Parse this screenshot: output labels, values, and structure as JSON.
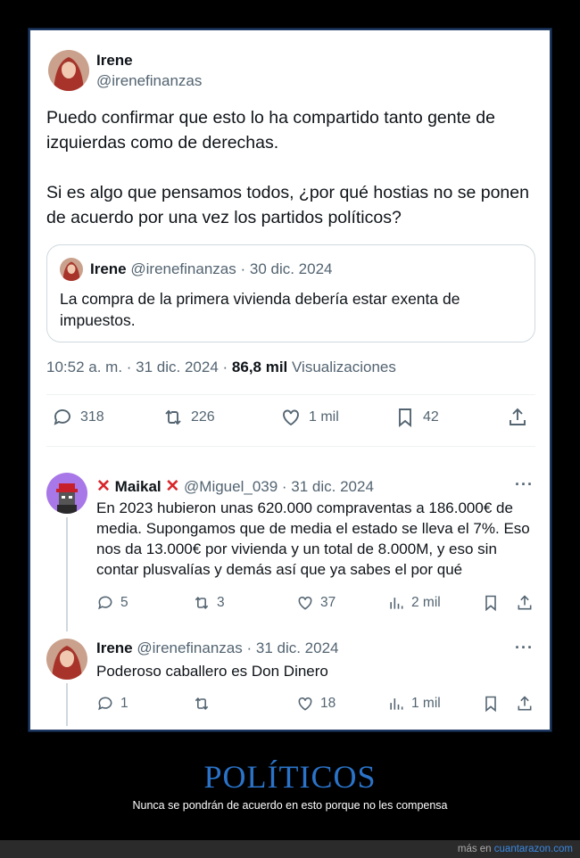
{
  "main": {
    "name": "Irene",
    "handle": "@irenefinanzas",
    "paragraph1": "Puedo confirmar que esto lo ha compartido tanto gente de izquierdas como de derechas.",
    "paragraph2": "Si es algo que pensamos todos, ¿por qué hostias no se ponen de acuerdo por una vez los partidos políticos?",
    "quote": {
      "name": "Irene",
      "handle_date": "@irenefinanzas · 30 dic. 2024",
      "text": "La compra de la primera vivienda debería estar exenta de impuestos."
    },
    "time": "10:52 a. m. · 31 dic. 2024 ·",
    "views_count": "86,8 mil",
    "views_label": "Visualizaciones",
    "stats": {
      "replies": "318",
      "reposts": "226",
      "likes": "1 mil",
      "bookmarks": "42"
    }
  },
  "replies": [
    {
      "name": "Maikal",
      "handle_date": "@Miguel_039 · 31 dic. 2024",
      "text": "En 2023 hubieron unas 620.000 compraventas a 186.000€ de media. Supongamos que de media el estado se lleva el 7%. Eso nos da 13.000€ por vivienda y un total de 8.000M, y eso sin contar plusvalías y demás así que ya sabes el por qué",
      "stats": {
        "replies": "5",
        "reposts": "3",
        "likes": "37",
        "views": "2 mil"
      }
    },
    {
      "name": "Irene",
      "handle_date": "@irenefinanzas · 31 dic. 2024",
      "text": "Poderoso caballero es Don Dinero",
      "stats": {
        "replies": "1",
        "reposts": "",
        "likes": "18",
        "views": "1 mil"
      }
    }
  ],
  "caption": {
    "title": "POLÍTICOS",
    "subtitle": "Nunca se pondrán de acuerdo en esto porque no les compensa"
  },
  "footer": {
    "prefix": "más en",
    "site": "cuantarazon.com"
  },
  "colors": {
    "accent": "#2a73c9",
    "text": "#0f1419",
    "muted": "#536471",
    "cross": "#d9262b"
  }
}
